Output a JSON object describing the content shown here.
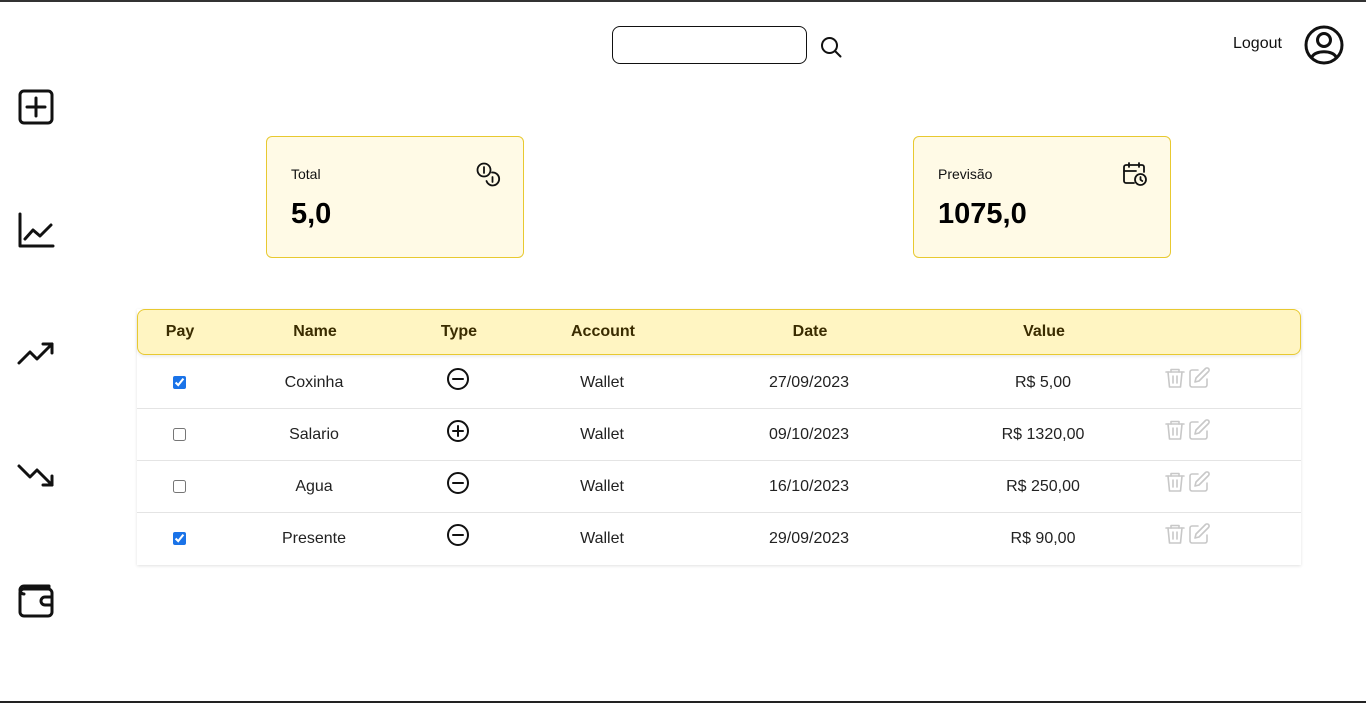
{
  "header": {
    "search": {
      "placeholder": "",
      "value": "",
      "icon": "search-icon"
    },
    "logout_label": "Logout",
    "avatar_icon": "user-circle-icon"
  },
  "sidebar": {
    "items": [
      {
        "name": "add",
        "icon": "plus-square-icon"
      },
      {
        "name": "chart",
        "icon": "line-chart-icon"
      },
      {
        "name": "income",
        "icon": "trending-up-icon"
      },
      {
        "name": "expenses",
        "icon": "trending-down-icon"
      },
      {
        "name": "wallet",
        "icon": "wallet-icon"
      }
    ]
  },
  "cards": {
    "total": {
      "label": "Total",
      "value": "5,0",
      "icon": "coins-icon"
    },
    "forecast": {
      "label": "Previsão",
      "value": "1075,0",
      "icon": "calendar-clock-icon"
    }
  },
  "table": {
    "headers": {
      "pay": "Pay",
      "name": "Name",
      "type": "Type",
      "account": "Account",
      "date": "Date",
      "value": "Value"
    },
    "rows": [
      {
        "paid": true,
        "name": "Coxinha",
        "type": "minus",
        "account": "Wallet",
        "date": "27/09/2023",
        "value": "R$ 5,00"
      },
      {
        "paid": false,
        "name": "Salario",
        "type": "plus",
        "account": "Wallet",
        "date": "09/10/2023",
        "value": "R$ 1320,00"
      },
      {
        "paid": false,
        "name": "Agua",
        "type": "minus",
        "account": "Wallet",
        "date": "16/10/2023",
        "value": "R$ 250,00"
      },
      {
        "paid": true,
        "name": "Presente",
        "type": "minus",
        "account": "Wallet",
        "date": "29/09/2023",
        "value": "R$ 90,00"
      }
    ]
  },
  "colors": {
    "accent": "#e8c930",
    "card_bg": "#fffae6",
    "header_bg": "#fff5c2",
    "action_icons": "#c8c8c8",
    "checkbox": "#1a73e8"
  }
}
